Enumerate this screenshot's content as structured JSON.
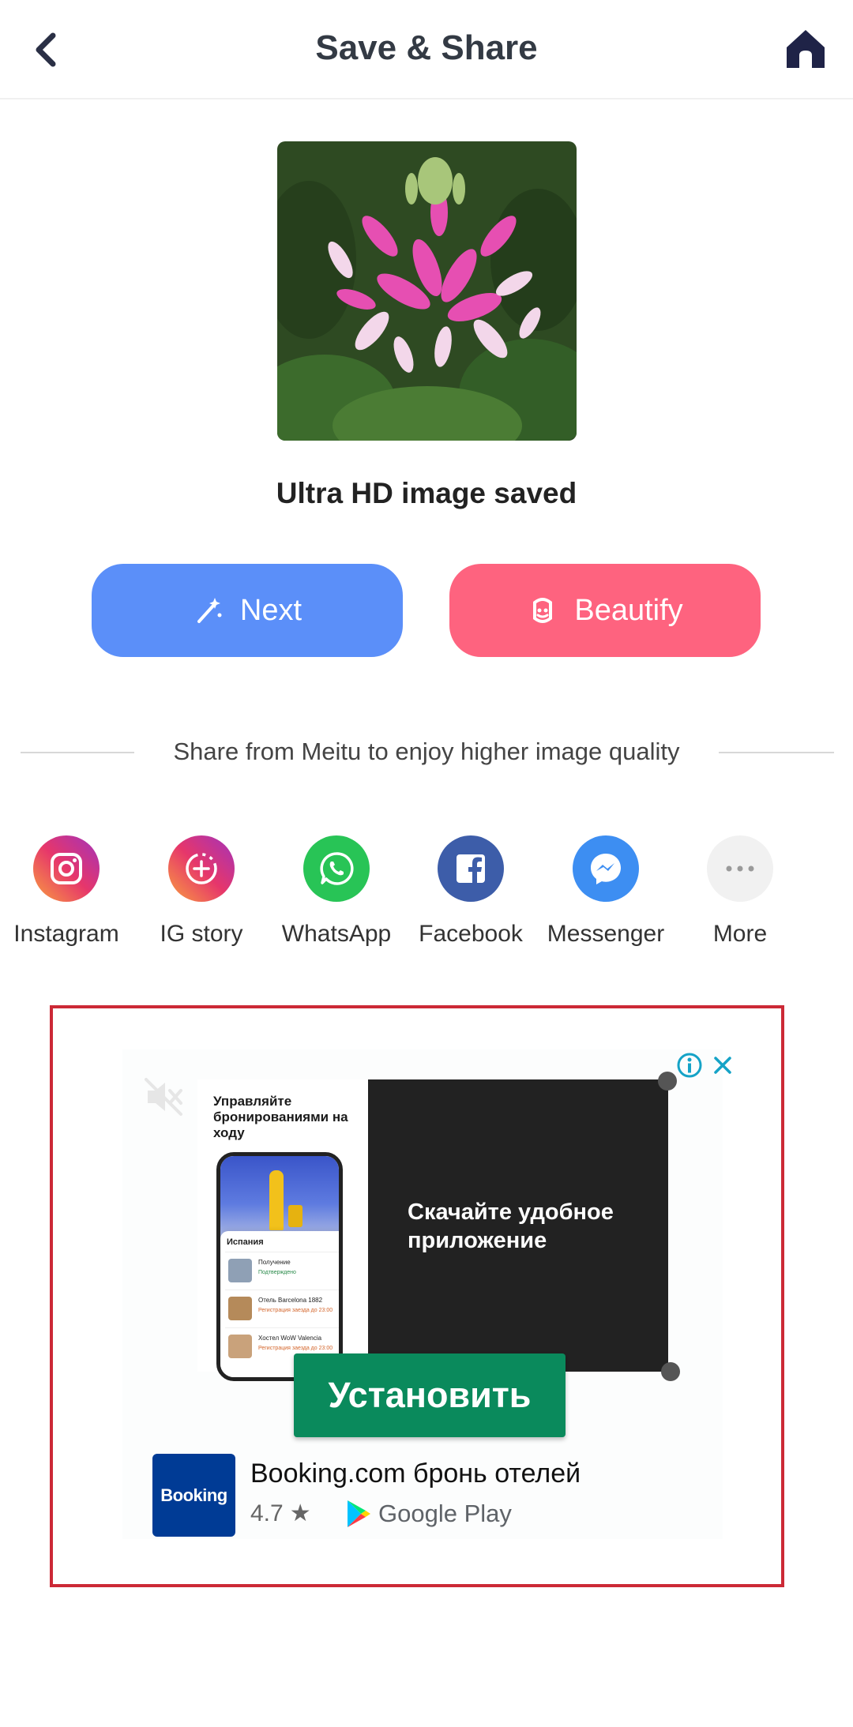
{
  "header": {
    "title": "Save & Share",
    "back_icon": "chevron-left-icon",
    "home_icon": "home-icon"
  },
  "preview": {
    "caption": "Ultra HD image saved"
  },
  "actions": {
    "next_label": "Next",
    "beautify_label": "Beautify",
    "next_color": "#5b8ff9",
    "beautify_color": "#fe637f"
  },
  "share": {
    "title": "Share from Meitu to enjoy higher image quality",
    "items": [
      {
        "label": "Instagram",
        "icon": "instagram-icon"
      },
      {
        "label": "IG story",
        "icon": "ig-story-icon"
      },
      {
        "label": "WhatsApp",
        "icon": "whatsapp-icon"
      },
      {
        "label": "Facebook",
        "icon": "facebook-icon"
      },
      {
        "label": "Messenger",
        "icon": "messenger-icon"
      },
      {
        "label": "More",
        "icon": "more-icon"
      }
    ]
  },
  "ad": {
    "left_headline": "Управляйте бронированиями на ходу",
    "phone_sheet_title": "Испания",
    "phone_rows": [
      {
        "t1": "Получение",
        "t2": "Подтверждено"
      },
      {
        "t1": "Отель Barcelona 1882",
        "t2": "Регистрация заезда до 23:00"
      },
      {
        "t1": "Хостел WoW Valencia",
        "t2": "Регистрация заезда до 23:00"
      }
    ],
    "dark_text": "Скачайте удобное приложение",
    "install_label": "Установить",
    "app_logo_text": "Booking",
    "app_name": "Booking.com бронь отелей",
    "rating": "4.7",
    "store": "Google Play",
    "border_color": "#cc2936"
  }
}
